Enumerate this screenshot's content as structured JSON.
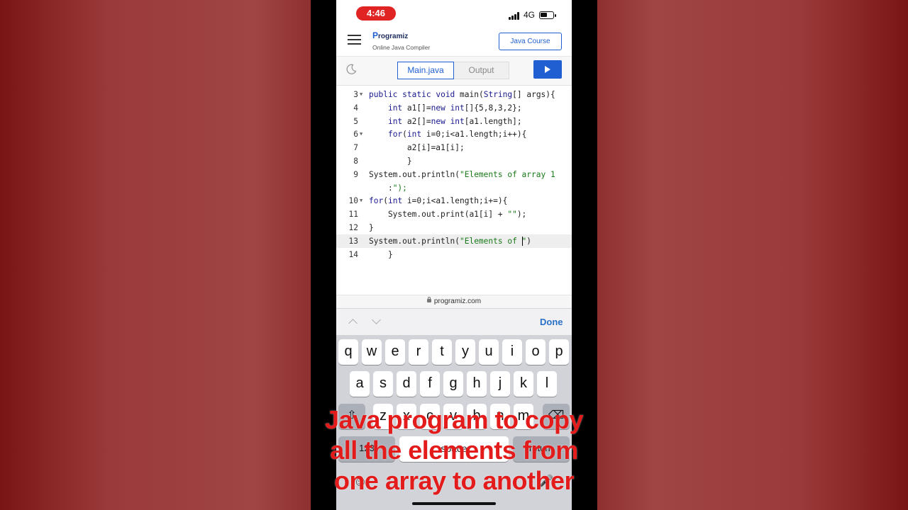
{
  "status_bar": {
    "time": "4:46",
    "network": "4G"
  },
  "header": {
    "logo": "Programiz",
    "logo_initial": "P",
    "logo_rest": "rogramiz",
    "subtitle": "Online Java Compiler",
    "course_button": "Java Course"
  },
  "toolbar": {
    "tab_main": "Main.java",
    "tab_output": "Output"
  },
  "editor": {
    "lines": [
      {
        "num": "3",
        "fold": true,
        "indent": "",
        "text": "public static void main(String[] args){"
      },
      {
        "num": "4",
        "fold": false,
        "indent": "    ",
        "text": "int a1[]=new int[]{5,8,3,2};"
      },
      {
        "num": "5",
        "fold": false,
        "indent": "    ",
        "text": "int a2[]=new int[a1.length];"
      },
      {
        "num": "6",
        "fold": true,
        "indent": "    ",
        "text": "for(int i=0;i<a1.length;i++){"
      },
      {
        "num": "7",
        "fold": false,
        "indent": "        ",
        "text": "a2[i]=a1[i];"
      },
      {
        "num": "8",
        "fold": false,
        "indent": "        ",
        "text": "}"
      },
      {
        "num": "9",
        "fold": false,
        "indent": "",
        "text": "System.out.println(\"Elements of array 1"
      },
      {
        "num": "",
        "fold": false,
        "indent": "    ",
        "text": ":\");"
      },
      {
        "num": "10",
        "fold": true,
        "indent": "",
        "text": "for(int i=0;i<a1.length;i+=){"
      },
      {
        "num": "11",
        "fold": false,
        "indent": "    ",
        "text": "System.out.print(a1[i] + \"\");"
      },
      {
        "num": "12",
        "fold": false,
        "indent": "",
        "text": "}"
      },
      {
        "num": "13",
        "fold": false,
        "indent": "",
        "text": "System.out.println(\"Elements of \")",
        "active": true
      },
      {
        "num": "14",
        "fold": false,
        "indent": "    ",
        "text": "}"
      }
    ]
  },
  "url_bar": {
    "domain": "programiz.com"
  },
  "accessory": {
    "done_label": "Done"
  },
  "keyboard": {
    "row1": [
      "q",
      "w",
      "e",
      "r",
      "t",
      "y",
      "u",
      "i",
      "o",
      "p"
    ],
    "row2": [
      "a",
      "s",
      "d",
      "f",
      "g",
      "h",
      "j",
      "k",
      "l"
    ],
    "row3": [
      "z",
      "x",
      "c",
      "v",
      "b",
      "n",
      "m"
    ],
    "numbers_key": "123",
    "space_label": "space"
  },
  "caption": {
    "line1": "Java program to copy",
    "line2": "all the elements from",
    "line3": "one array to another"
  }
}
